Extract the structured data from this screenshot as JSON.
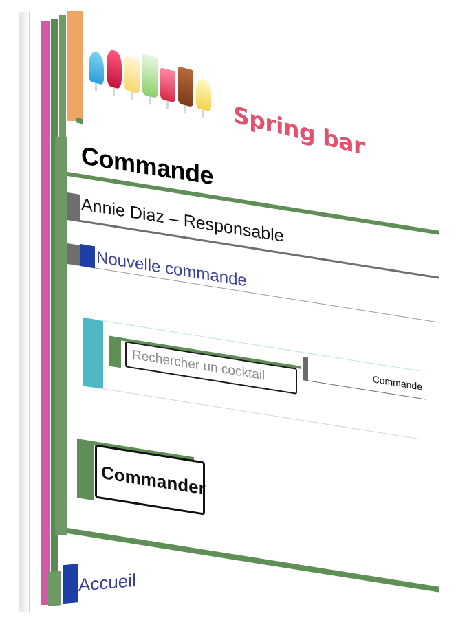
{
  "header": {
    "brand": "Spring bar",
    "brand_color": "#e0526e",
    "cocktail_icons": [
      "blue-lagoon-icon",
      "red-cocktail-icon",
      "citrus-drink-icon",
      "mojito-icon",
      "berry-drink-icon",
      "iced-tea-icon",
      "lemonade-icon"
    ]
  },
  "page": {
    "title": "Commande",
    "user": "Annie Diaz – Responsable"
  },
  "nav": {
    "new_order": "Nouvelle commande"
  },
  "search": {
    "placeholder": "Rechercher un cocktail",
    "value": ""
  },
  "commande_label": "Commande",
  "commander_label": "Commander",
  "footer": {
    "home": "Accueil"
  },
  "colors": {
    "green": "#5f8e57",
    "pink": "#d35aa2",
    "orange": "#f0a566",
    "teal": "#4fb7c3",
    "nav_blue": "#1d3fa6",
    "link": "#3c3f9c"
  }
}
